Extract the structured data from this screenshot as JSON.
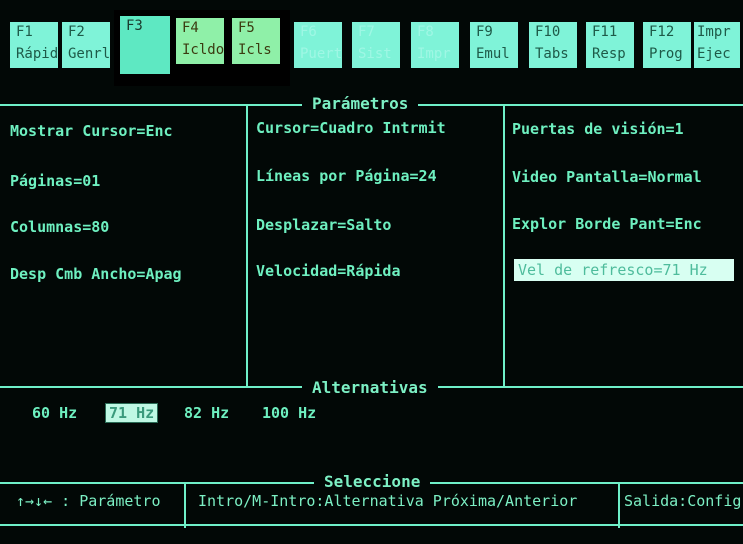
{
  "function_keys": [
    {
      "key": "F1",
      "label": "Rápid",
      "state": "normal"
    },
    {
      "key": "F2",
      "label": "Genrl",
      "state": "normal"
    },
    {
      "key": "F3",
      "label": "",
      "state": "selected"
    },
    {
      "key": "F4",
      "label": "Icldo",
      "state": "active"
    },
    {
      "key": "F5",
      "label": "Icls",
      "state": "active"
    },
    {
      "key": "F6",
      "label": "Puert",
      "state": "dim"
    },
    {
      "key": "F7",
      "label": "Sist",
      "state": "dim"
    },
    {
      "key": "F8",
      "label": "Impr",
      "state": "dim"
    },
    {
      "key": "F9",
      "label": "Emul",
      "state": "normal"
    },
    {
      "key": "F10",
      "label": "Tabs",
      "state": "normal"
    },
    {
      "key": "F11",
      "label": "Resp",
      "state": "normal"
    },
    {
      "key": "F12",
      "label": "Prog",
      "state": "normal"
    },
    {
      "key": "Impr",
      "label": "Ejec",
      "state": "normal"
    }
  ],
  "parametros": {
    "title": "Parámetros",
    "col1": [
      "Mostrar Cursor=Enc",
      "Páginas=01",
      "Columnas=80",
      "Desp Cmb Ancho=Apag"
    ],
    "col2": [
      "Cursor=Cuadro Intrmit",
      "Líneas por Página=24",
      "Desplazar=Salto",
      "Velocidad=Rápida"
    ],
    "col3": [
      "Puertas de visión=1",
      "Video Pantalla=Normal",
      "Explor Borde Pant=Enc",
      "Vel de refresco=71 Hz"
    ]
  },
  "alternativas": {
    "title": "Alternativas",
    "options": [
      "60 Hz",
      "71 Hz",
      "82 Hz",
      "100 Hz"
    ],
    "selected": "71 Hz"
  },
  "seleccione": {
    "title": "Seleccione",
    "left": "↑→↓← : Parámetro",
    "middle": "Intro/M-Intro:Alternativa Próxima/Anterior",
    "right": "Salida:Config"
  },
  "colors": {
    "phosphor": "#7cf0c4",
    "background": "#020806",
    "key_bg": "#7ff3d8"
  }
}
